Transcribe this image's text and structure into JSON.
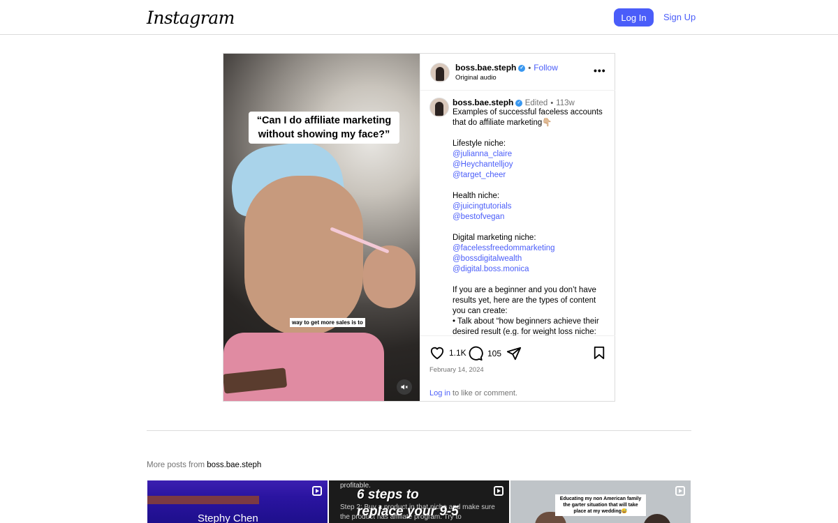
{
  "header": {
    "logo": "Instagram",
    "login_label": "Log In",
    "signup_label": "Sign Up"
  },
  "post": {
    "media": {
      "caption_top": "“Can I do affiliate marketing without showing my face?”",
      "caption_mid": "way to get more sales is to",
      "mute_icon": "speaker-muted-icon"
    },
    "author": {
      "username": "boss.bae.steph",
      "follow_label": "Follow",
      "audio": "Original audio"
    },
    "comment": {
      "username": "boss.bae.steph",
      "edited": "Edited",
      "age": "113w",
      "intro": "Examples of successful faceless accounts that do affiliate marketing👇🏼",
      "lifestyle_label": "Lifestyle niche:",
      "lifestyle_links": [
        "@julianna_claire",
        "@Heychantelljoy",
        "@target_cheer"
      ],
      "health_label": "Health niche:",
      "health_links": [
        "@juicingtutorials",
        "@bestofvegan"
      ],
      "digital_label": "Digital marketing niche:",
      "digital_links": [
        "@facelessfreedommarketing",
        "@bossdigitalwealth",
        "@digital.boss.monica"
      ],
      "beginner_text": "If you are a beginner and you don’t have results yet, here are the types of content you can create:",
      "bullet_text": "• Talk about “how beginners achieve their desired result (e.g. for weight loss niche:"
    },
    "likes": "1.1K",
    "comments": "105",
    "date": "February 14, 2024",
    "login_link": "Log in",
    "login_suffix": " to like or comment."
  },
  "more_posts": {
    "prefix": "More posts from ",
    "username": "boss.bae.steph",
    "thumbs": [
      {
        "text": "Stephy Chen"
      },
      {
        "small": "profitable.",
        "big": "6 steps to",
        "step": "Step 2: Buy a product in that niche and make sure the product has affiliate program. Try to",
        "big2": "replace your 9-5"
      },
      {
        "card": "Educating my non American family the garter situation that will take place at my wedding😅"
      }
    ]
  }
}
